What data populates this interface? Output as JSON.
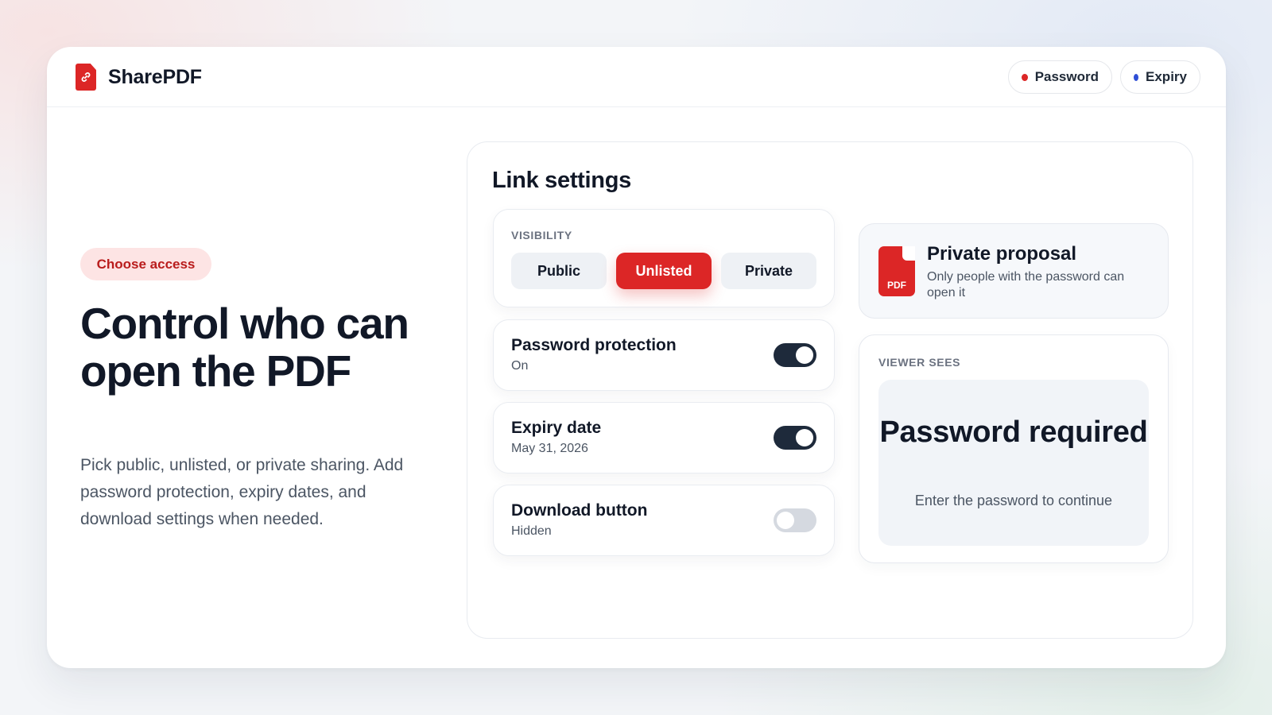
{
  "header": {
    "brand": "SharePDF",
    "logo_icon": "file-link-icon",
    "chips": [
      {
        "label": "Password",
        "dot_color": "#dc2626"
      },
      {
        "label": "Expiry",
        "dot_color": "#2f4fd6"
      }
    ]
  },
  "hero": {
    "pill": "Choose access",
    "title": "Control who can open the PDF",
    "description": "Pick public, unlisted, or private sharing. Add password protection, expiry dates, and download settings when needed."
  },
  "panel": {
    "title": "Link settings",
    "visibility": {
      "label": "VISIBILITY",
      "options": [
        "Public",
        "Unlisted",
        "Private"
      ],
      "selected": "Unlisted"
    },
    "settings": [
      {
        "title": "Password protection",
        "value": "On",
        "enabled": true
      },
      {
        "title": "Expiry date",
        "value": "May 31, 2026",
        "enabled": true
      },
      {
        "title": "Download button",
        "value": "Hidden",
        "enabled": false
      }
    ],
    "document": {
      "icon_label": "PDF",
      "title": "Private proposal",
      "description": "Only people with the password can open it"
    },
    "viewer": {
      "label": "VIEWER SEES",
      "title": "Password required",
      "subtitle": "Enter the password to continue"
    }
  },
  "colors": {
    "accent": "#dc2626",
    "toggle_on": "#1e2a3b",
    "toggle_off": "#d5d9e0"
  }
}
